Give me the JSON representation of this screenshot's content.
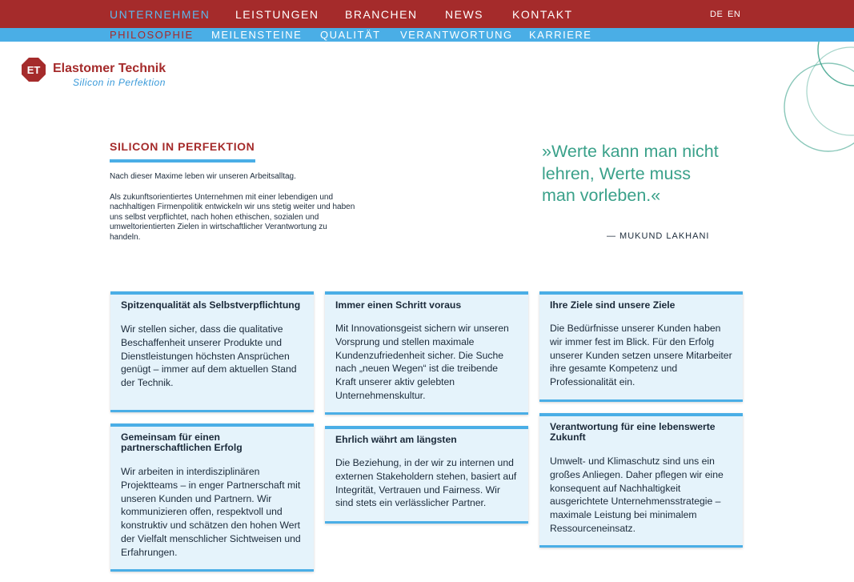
{
  "nav": {
    "items": [
      "UNTERNEHMEN",
      "LEISTUNGEN",
      "BRANCHEN",
      "NEWS",
      "KONTAKT"
    ],
    "active_index": 0,
    "languages": [
      "DE",
      "EN"
    ]
  },
  "subnav": {
    "items": [
      "PHILOSOPHIE",
      "MEILENSTEINE",
      "QUALITÄT",
      "VERANTWORTUNG",
      "KARRIERE"
    ],
    "active_index": 0
  },
  "logo": {
    "initials": "ET",
    "name": "Elastomer Technik",
    "tagline": "Silicon in Perfektion"
  },
  "intro": {
    "heading": "SILICON IN PERFEKTION",
    "p1": "Nach dieser Maxime leben wir unseren Arbeitsalltag.",
    "p2": "Als zukunftsorientiertes Unternehmen mit einer lebendigen und nachhaltigen Firmenpolitik entwickeln wir uns stetig weiter und haben uns selbst verpflichtet, nach hohen ethischen, sozialen und umweltorientierten Zielen in wirtschaftlicher Verantwortung zu handeln."
  },
  "quote": {
    "text": "»Werte kann man nicht lehren, Werte muss man vorleben.«",
    "author": "— MUKUND LAKHANI"
  },
  "cards": [
    {
      "title": "Spitzenqualität als Selbstverpflichtung",
      "text": "Wir stellen sicher, dass die qualitative Beschaffenheit unserer Produkte und Dienstleistungen höchsten Ansprüchen genügt – immer auf dem aktuellen Stand der Technik."
    },
    {
      "title": "Immer einen Schritt voraus",
      "text": "Mit Innovationsgeist sichern wir unseren Vorsprung und stellen maximale Kundenzufriedenheit sicher. Die Suche nach „neuen Wegen“ ist die treibende Kraft unserer aktiv gelebten Unternehmenskultur."
    },
    {
      "title": "Ihre Ziele sind unsere Ziele",
      "text": "Die Bedürfnisse unserer Kunden haben wir immer fest im Blick. Für den Erfolg unserer Kunden setzen unsere Mitarbeiter ihre gesamte Kompetenz und Professionalität ein."
    },
    {
      "title": "Gemeinsam für einen partnerschaftlichen Erfolg",
      "text": "Wir arbeiten in interdisziplinären Projektteams – in enger Partnerschaft mit unseren Kunden und Partnern. Wir kommunizieren offen, respektvoll und konstruktiv und schätzen den hohen Wert der Vielfalt menschlicher Sichtweisen und Erfahrungen."
    },
    {
      "title": "Ehrlich währt am längsten",
      "text": "Die Beziehung, in der wir zu internen und externen Stakeholdern stehen, basiert auf Integrität, Vertrauen und Fairness. Wir sind stets ein verlässlicher Partner."
    },
    {
      "title": "Verantwortung für eine lebenswerte Zukunft",
      "text": "Umwelt- und Klimaschutz sind uns ein großes Anliegen. Daher pflegen wir eine konsequent auf Nachhaltigkeit ausgerichtete Unternehmensstrategie – maximale Leistung bei minimalem Ressourceneinsatz."
    }
  ],
  "colors": {
    "brand_red": "#a52b2b",
    "brand_blue": "#4aaee6",
    "quote_green": "#3aa18a",
    "card_bg": "#e5f3fb"
  }
}
